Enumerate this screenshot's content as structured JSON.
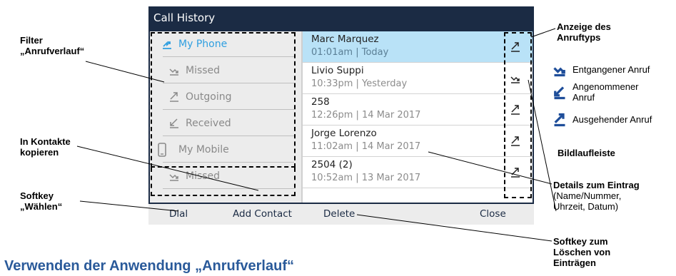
{
  "screen": {
    "title": "Call History",
    "filters": [
      {
        "label": "My Phone",
        "icon": "all-calls-icon",
        "selected": true
      },
      {
        "label": "Missed",
        "icon": "missed-call-icon",
        "selected": false
      },
      {
        "label": "Outgoing",
        "icon": "outgoing-call-icon",
        "selected": false
      },
      {
        "label": "Received",
        "icon": "received-call-icon",
        "selected": false
      },
      {
        "label": "My Mobile",
        "icon": "mobile-phone-icon",
        "selected": false
      },
      {
        "label": "Missed",
        "icon": "missed-call-icon",
        "selected": false
      }
    ],
    "entries": [
      {
        "name": "Marc Marquez",
        "detail": "01:01am | Today",
        "icon": "outgoing-call-icon",
        "selected": true
      },
      {
        "name": "Livio Suppi",
        "detail": "10:33pm | Yesterday",
        "icon": "missed-call-icon",
        "selected": false
      },
      {
        "name": "258",
        "detail": "12:26pm | 14 Mar 2017",
        "icon": "outgoing-call-icon",
        "selected": false
      },
      {
        "name": "Jorge Lorenzo",
        "detail": "11:02am | 14 Mar 2017",
        "icon": "outgoing-call-icon",
        "selected": false
      },
      {
        "name": "2504 (2)",
        "detail": "10:52am | 13 Mar 2017",
        "icon": "outgoing-call-icon",
        "selected": false
      }
    ],
    "softkeys": {
      "dial": "Dial",
      "add_contact": "Add Contact",
      "delete": "Delete",
      "close": "Close"
    }
  },
  "callouts": {
    "filter_line1": "Filter",
    "filter_line2": "„Anrufverlauf“",
    "copy_line1": "In Kontakte",
    "copy_line2": "kopieren",
    "dial_line1": "Softkey",
    "dial_line2": "„Wählen“",
    "type_line1": "Anzeige des",
    "type_line2": "Anruftyps",
    "legend_missed": "Entgangener Anruf",
    "legend_received_line1": "Angenommener",
    "legend_received_line2": "Anruf",
    "legend_outgoing": "Ausgehender Anruf",
    "scrollbar": "Bildlaufleiste",
    "details_line1": "Details zum Eintrag",
    "details_line2": "(Name/Nummer,",
    "details_line3": "Uhrzeit, Datum)",
    "delete_line1": "Softkey zum",
    "delete_line2": "Löschen von",
    "delete_line3": "Einträgen"
  },
  "heading": "Verwenden der Anwendung „Anrufverlauf“",
  "colors": {
    "title_bar": "#1b2b44",
    "selected_row": "#b9e2f7",
    "accent": "#2f9fe0",
    "legend_icon": "#1f4e9a"
  }
}
